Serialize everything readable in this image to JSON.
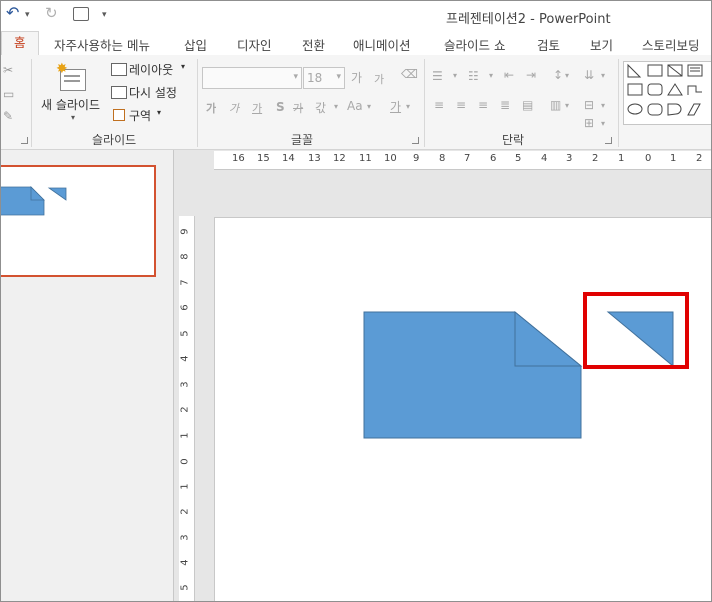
{
  "window": {
    "title": "프레젠테이션2 - PowerPoint"
  },
  "qat": {
    "undo": "↶",
    "redo": "↻",
    "dropdown": "▾"
  },
  "tabs": [
    "홈",
    "자주사용하는 메뉴",
    "삽입",
    "디자인",
    "전환",
    "애니메이션",
    "슬라이드 쇼",
    "검토",
    "보기",
    "스토리보딩"
  ],
  "ribbon": {
    "slides": {
      "new_slide": "새 슬라이드",
      "layout": "레이아웃",
      "reset": "다시 설정",
      "section": "구역",
      "group_label": "슬라이드"
    },
    "font": {
      "size": "18",
      "group_label": "글꼴",
      "grow": "가",
      "shrink": "가",
      "bold": "가",
      "italic": "가",
      "underline": "가",
      "strike": "S",
      "spacing": "AV",
      "case": "Aa",
      "color": "가",
      "spacing_kr": "갃"
    },
    "paragraph": {
      "group_label": "단락"
    }
  },
  "colors": {
    "accent": "#c43e1c",
    "shape_fill": "#5b9bd5",
    "shape_stroke": "#41719c",
    "highlight": "#e00000"
  },
  "ruler": {
    "h_ticks": [
      "16",
      "15",
      "14",
      "13",
      "12",
      "11",
      "10",
      "9",
      "8",
      "7",
      "6",
      "5",
      "4",
      "3",
      "2",
      "1",
      "0",
      "1",
      "2"
    ],
    "v_ticks": [
      "9",
      "8",
      "7",
      "6",
      "5",
      "4",
      "3",
      "2",
      "1",
      "0",
      "1",
      "2",
      "3",
      "4",
      "5"
    ]
  }
}
